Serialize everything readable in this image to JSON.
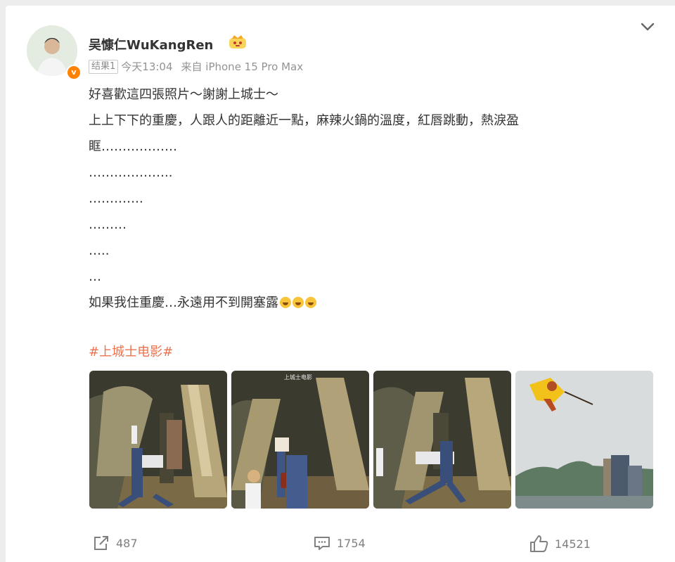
{
  "post": {
    "username": "吴慷仁WuKangRen",
    "badge_tag": "结果1",
    "time": "今天13:04",
    "source": "来自 iPhone 15 Pro Max",
    "lines": [
      "好喜歡這四張照片～謝謝上城士～",
      "上上下下的重慶，人跟人的距離近一點，麻辣火鍋的溫度，紅唇跳動，熱淚盈",
      "眶………………",
      "………………..",
      "………….",
      "………",
      "…..",
      "…",
      "如果我住重慶…永遠用不到開塞露"
    ],
    "hashtag": "#上城士电影#",
    "photo2_caption": "上城士电影"
  },
  "actions": {
    "repost_count": "487",
    "comment_count": "1754",
    "like_count": "14521"
  },
  "colors": {
    "accent": "#ff8200",
    "hashtag": "#eb7350",
    "meta": "#939393"
  },
  "icons": [
    "chevron-down-icon",
    "share-icon",
    "comment-icon",
    "like-icon",
    "vip-crown-icon",
    "laughing-emoji-icon"
  ]
}
